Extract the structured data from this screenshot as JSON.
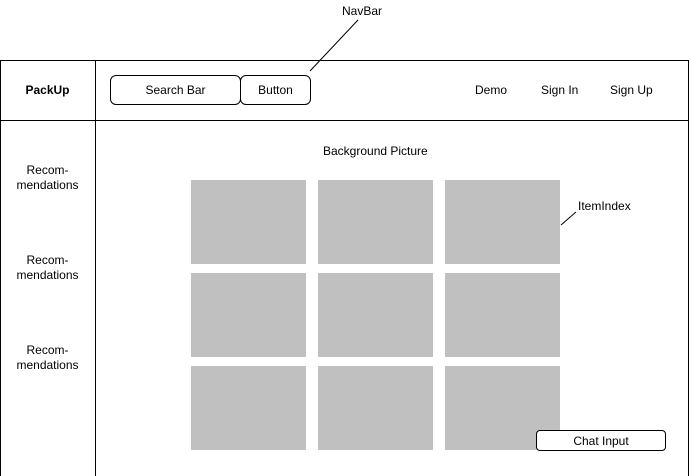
{
  "annotations": {
    "navbar": "NavBar",
    "item_index": "ItemIndex"
  },
  "header": {
    "logo": "PackUp",
    "search_label": "Search Bar",
    "button_label": "Button",
    "nav_links": [
      "Demo",
      "Sign In",
      "Sign Up"
    ]
  },
  "sidebar": {
    "items": [
      {
        "line1": "Recom-",
        "line2": "mendations"
      },
      {
        "line1": "Recom-",
        "line2": "mendations"
      },
      {
        "line1": "Recom-",
        "line2": "mendations"
      }
    ]
  },
  "main": {
    "background_label": "Background Picture",
    "chat_input_label": "Chat Input",
    "tile_color": "#c0c0c0",
    "grid_rows": 3,
    "grid_cols": 3
  }
}
